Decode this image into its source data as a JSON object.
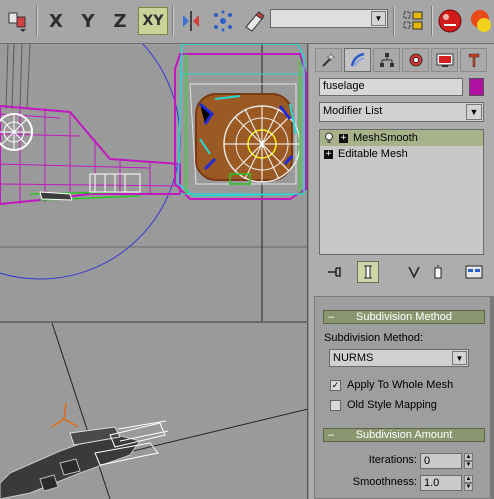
{
  "toolbar": {
    "axis_x": "X",
    "axis_y": "Y",
    "axis_z": "Z",
    "axis_xy": "XY",
    "named_selection_set": "",
    "icons": [
      "render-setup-icon",
      "snap-toggle-icon",
      "mirror-icon",
      "align-icon",
      "selection-lock-icon",
      "layer-manager-icon",
      "render-teapot-icon",
      "material-editor-icon"
    ]
  },
  "command_panel": {
    "tabs": [
      "create-tab",
      "modify-tab",
      "hierarchy-tab",
      "motion-tab",
      "display-tab",
      "utilities-tab"
    ],
    "object_name": "fuselage",
    "object_color": "#b10f9f",
    "modifier_list_label": "Modifier List",
    "stack": [
      {
        "label": "MeshSmooth",
        "selected": true
      },
      {
        "label": "Editable Mesh",
        "selected": false
      }
    ]
  },
  "subdivision_method_rollout": {
    "title": "Subdivision Method",
    "method_label": "Subdivision Method:",
    "method_value": "NURMS",
    "apply_whole_mesh_label": "Apply To Whole Mesh",
    "apply_whole_mesh_checked": true,
    "old_style_mapping_label": "Old Style Mapping",
    "old_style_mapping_checked": false
  },
  "subdivision_amount_rollout": {
    "title": "Subdivision Amount",
    "iterations_label": "Iterations:",
    "iterations_value": "0",
    "smoothness_label": "Smoothness:",
    "smoothness_value": "1.0"
  },
  "colors": {
    "accent": "#8a9670",
    "viewport_bg": "#9a9a9a",
    "wire_magenta": "#c218c2",
    "wire_cyan": "#28d6d6"
  }
}
